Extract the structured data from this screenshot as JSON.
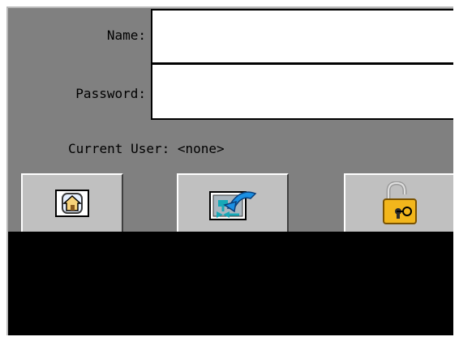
{
  "form": {
    "name_label": "Name:",
    "name_value": "",
    "password_label": "Password:",
    "password_value": ""
  },
  "status": {
    "current_user_text": "Current User: <none>"
  },
  "buttons": [
    {
      "icon": "home-icon"
    },
    {
      "icon": "back-to-screen-icon"
    },
    {
      "icon": "unlock-icon"
    }
  ],
  "colors": {
    "panel": "#808080",
    "button": "#c0c0c0",
    "field": "#ffffff",
    "lower_area": "#000000"
  }
}
